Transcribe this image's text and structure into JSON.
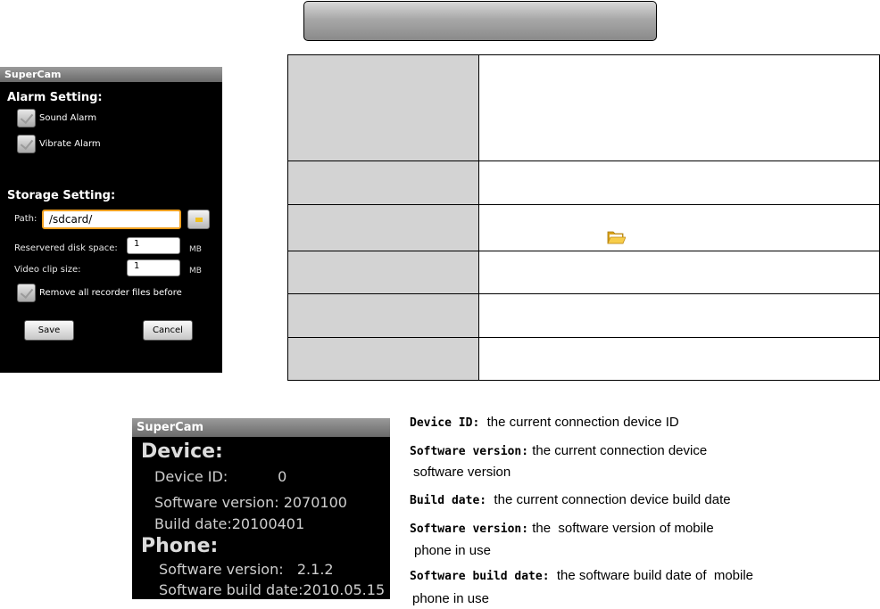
{
  "header": {
    "title": ""
  },
  "settings_screen": {
    "app_title": "SuperCam",
    "alarm_heading": "Alarm Setting:",
    "sound_alarm": "Sound Alarm",
    "vibrate_alarm": "Vibrate Alarm",
    "storage_heading": "Storage Setting:",
    "path_label": "Path:",
    "path_value": "/sdcard/",
    "reserved_label": "Reservered disk space:",
    "reserved_value": "1",
    "reserved_unit": "MB",
    "clip_label": "Video clip size:",
    "clip_value": "1",
    "clip_unit": "MB",
    "remove_label": "Remove all recorder files before",
    "save_label": "Save",
    "cancel_label": "Cancel"
  },
  "table": {
    "rows": [
      {
        "label": "",
        "value": ""
      },
      {
        "label": "",
        "value": ""
      },
      {
        "label": "",
        "value": ""
      },
      {
        "label": "",
        "value": ""
      },
      {
        "label": "",
        "value": ""
      },
      {
        "label": "",
        "value": ""
      }
    ]
  },
  "about_screen": {
    "app_title": "SuperCam",
    "device_heading": "Device:",
    "device_id": "Device ID:           0",
    "device_sw": "Software version: 2070100",
    "device_build": "Build date:20100401",
    "phone_heading": "Phone:",
    "phone_sw": "Software version:   2.1.2",
    "phone_build": "Software build date:2010.05.15"
  },
  "descriptions": [
    {
      "term": "Device ID:",
      "text": "  the current connection device ID",
      "cont": ""
    },
    {
      "term": "Software version:",
      "text": " the current connection device",
      "cont": "software version"
    },
    {
      "term": "Build date:",
      "text": "  the current connection device build date",
      "cont": ""
    },
    {
      "term": "Software version:",
      "text": " the  software version of mobile",
      "cont": "phone in use"
    },
    {
      "term": "Software build date:",
      "text": "  the software build date of  mobile",
      "cont": "phone in use"
    }
  ],
  "colors": {
    "header_gradient_top": "#d8d8d8",
    "header_gradient_bottom": "#8a8a8a",
    "table_label_bg": "#d3d3d3",
    "path_focus": "#f0a020",
    "folder": "#f0c020"
  }
}
